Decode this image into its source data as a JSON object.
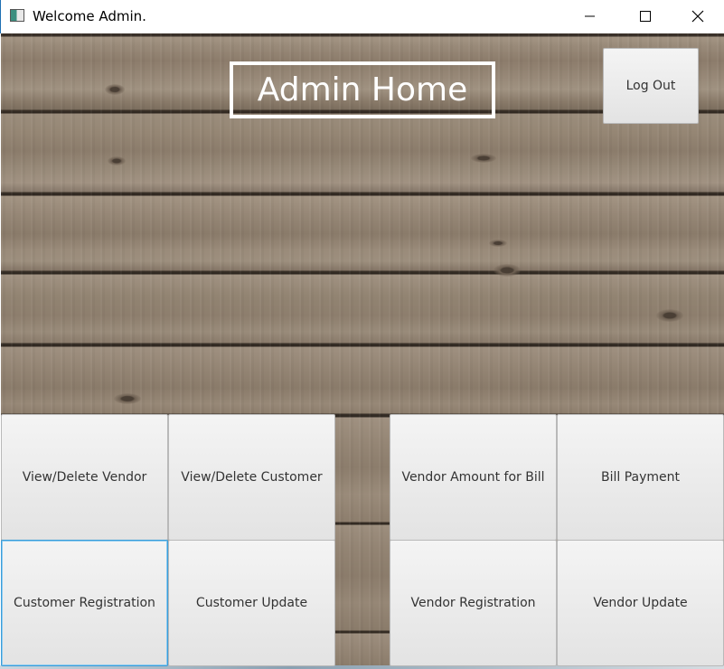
{
  "window": {
    "title": "Welcome Admin.",
    "icon": "java-app-icon",
    "controls": {
      "minimize": "minimize-icon",
      "maximize": "maximize-icon",
      "close": "close-icon"
    }
  },
  "header": {
    "title": "Admin Home",
    "logout_label": "Log Out"
  },
  "left_panel": {
    "buttons": [
      {
        "label": "View/Delete Vendor"
      },
      {
        "label": "View/Delete Customer"
      },
      {
        "label": "Customer Registration"
      },
      {
        "label": "Customer Update"
      }
    ]
  },
  "right_panel": {
    "buttons": [
      {
        "label": "Vendor Amount for Bill"
      },
      {
        "label": "Bill Payment"
      },
      {
        "label": "Vendor Registration"
      },
      {
        "label": "Vendor Update"
      }
    ]
  },
  "colors": {
    "wood_base": "#8f8172",
    "title_text": "#ffffff",
    "button_bg": "#ececec",
    "focus_border": "#3a9dd9"
  }
}
